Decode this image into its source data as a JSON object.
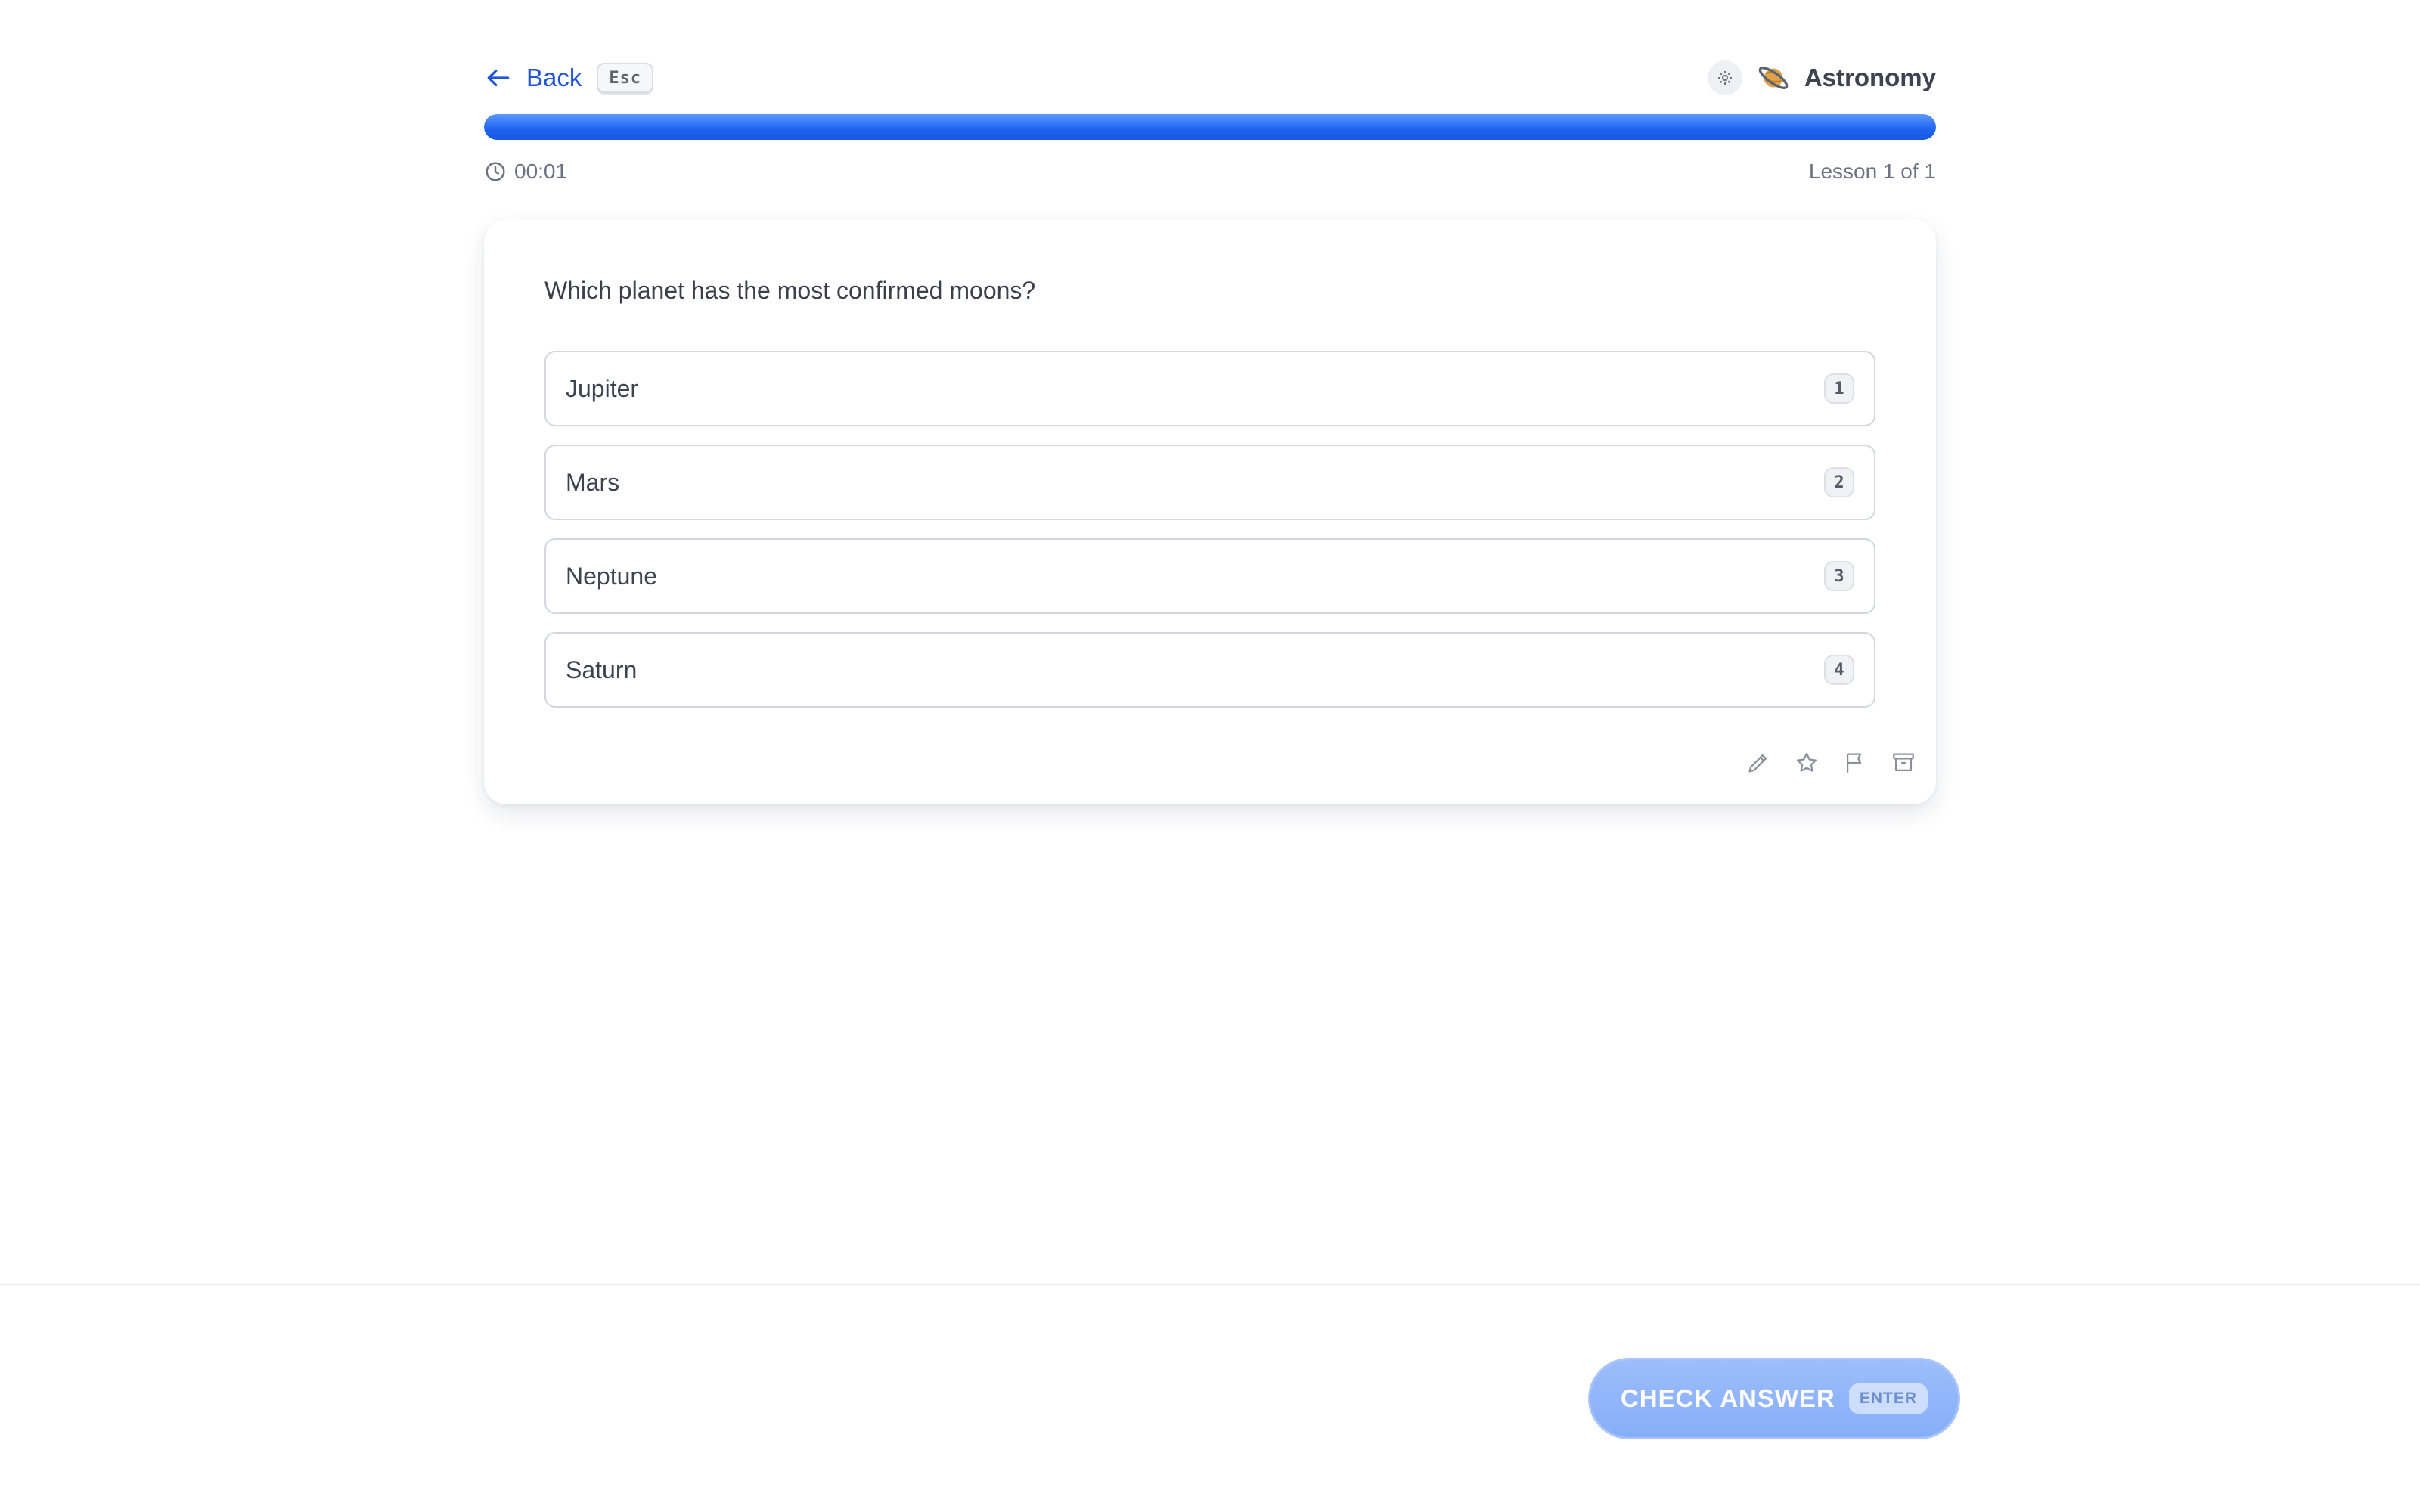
{
  "header": {
    "back_label": "Back",
    "back_shortcut": "Esc",
    "course_name": "Astronomy",
    "course_icon": "ringed-planet-icon"
  },
  "progress": {
    "fraction": 1.0,
    "timer": "00:01",
    "lesson_counter": "Lesson 1 of 1"
  },
  "question": {
    "text": "Which planet has the most confirmed moons?",
    "options": [
      {
        "label": "Jupiter",
        "key": "1"
      },
      {
        "label": "Mars",
        "key": "2"
      },
      {
        "label": "Neptune",
        "key": "3"
      },
      {
        "label": "Saturn",
        "key": "4"
      }
    ]
  },
  "card_tools": [
    "pencil-icon",
    "star-icon",
    "flag-icon",
    "archive-icon"
  ],
  "footer": {
    "check_label": "CHECK ANSWER",
    "check_shortcut": "ENTER"
  },
  "colors": {
    "accent": "#1f55d6",
    "progress": "#1d63f0",
    "check_button": "#8fb3fa"
  }
}
